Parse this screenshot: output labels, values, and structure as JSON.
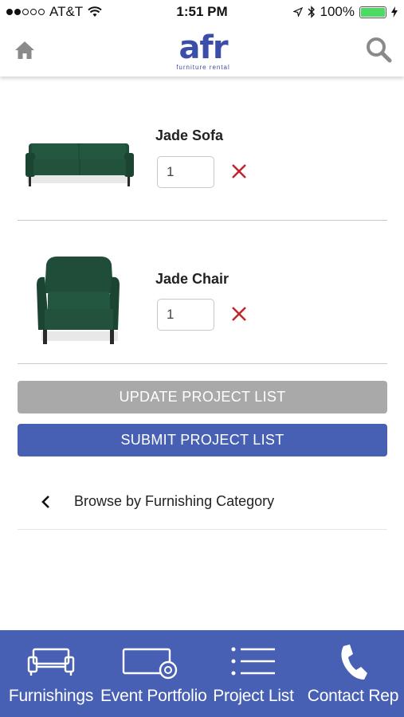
{
  "status_bar": {
    "carrier": "AT&T",
    "time": "1:51 PM",
    "battery": "100%"
  },
  "header": {
    "logo_text": "afr",
    "logo_subtitle": "furniture rental"
  },
  "items": [
    {
      "name": "Jade Sofa",
      "quantity": "1"
    },
    {
      "name": "Jade Chair",
      "quantity": "1"
    }
  ],
  "actions": {
    "update_label": "UPDATE PROJECT LIST",
    "submit_label": "SUBMIT PROJECT LIST"
  },
  "browse": {
    "label": "Browse by Furnishing Category"
  },
  "tab_bar": {
    "tabs": [
      {
        "label": "Furnishings",
        "icon": "sofa-icon"
      },
      {
        "label": "Event Portfolio",
        "icon": "portfolio-icon"
      },
      {
        "label": "Project List",
        "icon": "list-icon"
      },
      {
        "label": "Contact Rep",
        "icon": "phone-icon"
      }
    ]
  },
  "colors": {
    "brand": "#4760b3",
    "update_button": "#a9a9a9",
    "remove": "#c0262d"
  }
}
